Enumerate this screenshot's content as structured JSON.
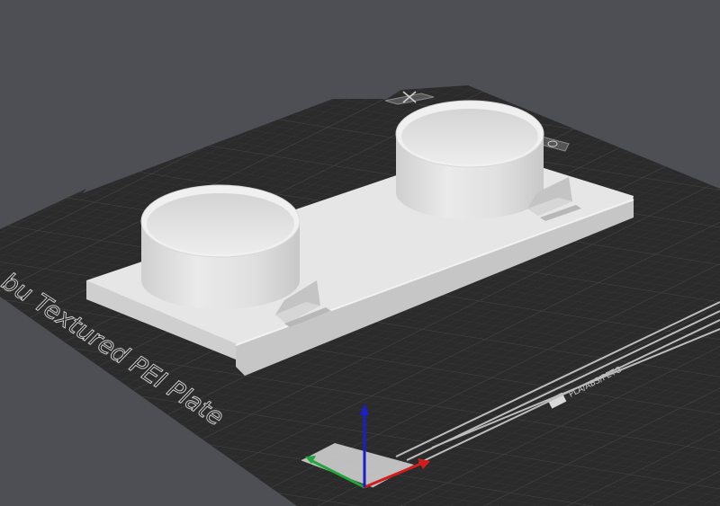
{
  "viewport": {
    "background_color": "#4d4f55",
    "bed": {
      "label": "bu Textured PEI Plate",
      "materials_label": "PLA/ABS/PETG",
      "bed_color": "#2b2b2c",
      "grid_color": "#3b3b3d",
      "edge_color": "#303032"
    },
    "model": {
      "color": "#e4e4e4",
      "shadow_color": "#bdbdbd",
      "description": "plate with two cylindrical cups"
    },
    "axes": {
      "x_color": "#d21d1d",
      "y_color": "#22a53a",
      "z_color": "#1a1fc8"
    },
    "icons": {
      "plate_close": "close-icon",
      "plate_settings": "gear-icon"
    }
  }
}
